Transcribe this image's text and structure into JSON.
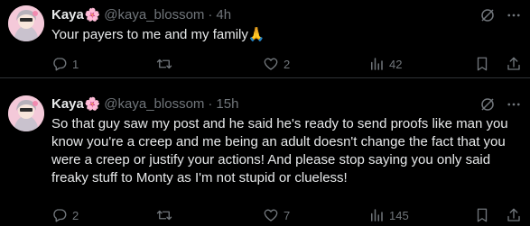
{
  "tweets": [
    {
      "author_name": "Kaya",
      "name_emoji": "🌸",
      "handle": "@kaya_blossom",
      "separator": "·",
      "time": "4h",
      "text": "Your payers to me and my family🙏",
      "replies": "1",
      "retweets": "",
      "likes": "2",
      "views": "42"
    },
    {
      "author_name": "Kaya",
      "name_emoji": "🌸",
      "handle": "@kaya_blossom",
      "separator": "·",
      "time": "15h",
      "text": "So that guy saw my post and he said he's ready to send proofs like man you know you're a creep and  me being an adult doesn't change the fact that you were a creep or justify your actions! And please stop saying you only said freaky stuff to Monty as I'm not stupid or clueless!",
      "replies": "2",
      "retweets": "",
      "likes": "7",
      "views": "145"
    }
  ],
  "icons": {
    "reply": "reply-icon",
    "retweet": "retweet-icon",
    "like": "heart-icon",
    "views": "views-icon",
    "bookmark": "bookmark-icon",
    "share": "share-icon",
    "grok": "grok-icon",
    "more": "more-icon"
  },
  "colors": {
    "background": "#000000",
    "primary_text": "#e7e9ea",
    "secondary_text": "#71767b",
    "divider": "#2f3336"
  }
}
